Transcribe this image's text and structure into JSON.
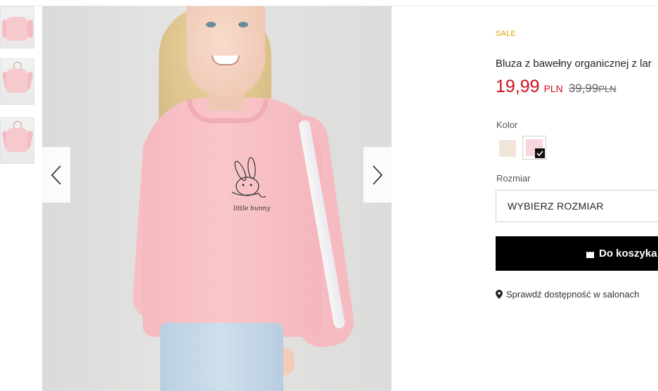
{
  "product": {
    "badge": "SALE",
    "title": "Bluza z bawełny organicznej z lar",
    "price": "19,99",
    "currency": "PLN",
    "old_price": "39,99",
    "old_currency": "PLN"
  },
  "color": {
    "label": "Kolor",
    "options": [
      {
        "name": "beige",
        "hex": "#f2e6db"
      },
      {
        "name": "pink",
        "hex": "#f7d7dd",
        "selected": true
      }
    ]
  },
  "size": {
    "label": "Rozmiar",
    "select_value": "WYBIERZ ROZMIAR"
  },
  "cart": {
    "label": "Do koszyka"
  },
  "store_check": {
    "label": "Sprawdź dostępność w salonach"
  },
  "gallery": {
    "print_text": "little bunny",
    "prev_icon": "chevron-left-icon",
    "next_icon": "chevron-right-icon"
  },
  "colors": {
    "accent_red": "#d0101a",
    "sale_yellow": "#e0a400",
    "sweater_pink": "#f7c3c8"
  }
}
